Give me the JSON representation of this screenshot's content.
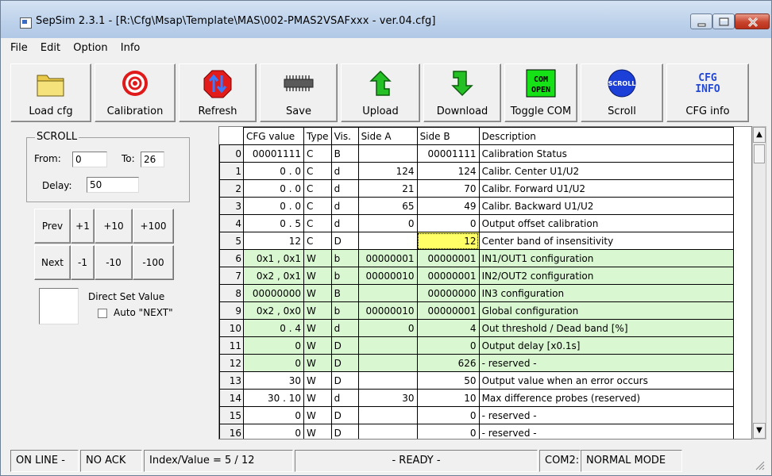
{
  "window": {
    "title": "SepSim 2.3.1 - [R:\\Cfg\\Msap\\Template\\MAS\\002-PMAS2VSAFxxx - ver.04.cfg]"
  },
  "menu": [
    {
      "label": "File"
    },
    {
      "label": "Edit"
    },
    {
      "label": "Option"
    },
    {
      "label": "Info"
    }
  ],
  "toolbar": [
    {
      "label": "Load cfg",
      "icon": "folder-icon"
    },
    {
      "label": "Calibration",
      "icon": "target-icon"
    },
    {
      "label": "Refresh",
      "icon": "refresh-arrows-icon"
    },
    {
      "label": "Save",
      "icon": "chip-icon"
    },
    {
      "label": "Upload",
      "icon": "upload-arrow-icon"
    },
    {
      "label": "Download",
      "icon": "download-arrow-icon"
    },
    {
      "label": "Toggle COM",
      "icon": "com-open-icon",
      "icon_text": [
        "COM",
        "OPEN"
      ]
    },
    {
      "label": "Scroll",
      "icon": "scroll-icon",
      "icon_text": "SCROLL"
    },
    {
      "label": "CFG info",
      "icon": "cfg-info-icon",
      "icon_text": [
        "CFG",
        "INFO"
      ]
    }
  ],
  "scroll": {
    "legend": "SCROLL",
    "from_label": "From:",
    "from_value": "0",
    "to_label": "To:",
    "to_value": "26",
    "delay_label": "Delay:",
    "delay_value": "50"
  },
  "step_buttons": {
    "prev": "Prev",
    "next": "Next",
    "p1": "+1",
    "p10": "+10",
    "p100": "+100",
    "m1": "-1",
    "m10": "-10",
    "m100": "-100"
  },
  "direct_set": {
    "label": "Direct Set Value",
    "auto_next": "Auto \"NEXT\""
  },
  "grid": {
    "columns": [
      "CFG value",
      "Type",
      "Vis.",
      "Side A",
      "Side B",
      "Description"
    ],
    "rows": [
      {
        "idx": "0",
        "cfg": "00001111",
        "type": "C",
        "vis": "B",
        "a": "",
        "b": "00001111",
        "desc": "Calibration Status",
        "green": false
      },
      {
        "idx": "1",
        "cfg": "0 .  0",
        "type": "C",
        "vis": "d",
        "a": "124",
        "b": "124",
        "desc": "Calibr. Center U1/U2",
        "green": false
      },
      {
        "idx": "2",
        "cfg": "0 .  0",
        "type": "C",
        "vis": "d",
        "a": "21",
        "b": "70",
        "desc": "Calibr. Forward U1/U2",
        "green": false
      },
      {
        "idx": "3",
        "cfg": "0 .  0",
        "type": "C",
        "vis": "d",
        "a": "65",
        "b": "49",
        "desc": "Calibr. Backward U1/U2",
        "green": false
      },
      {
        "idx": "4",
        "cfg": "0 .  5",
        "type": "C",
        "vis": "d",
        "a": "0",
        "b": "0",
        "desc": "Output offset calibration",
        "green": false
      },
      {
        "idx": "5",
        "cfg": "12",
        "type": "C",
        "vis": "D",
        "a": "",
        "b": "12",
        "desc": "Center band of insensitivity",
        "green": false,
        "selected_b": true
      },
      {
        "idx": "6",
        "cfg": "0x1 , 0x1",
        "type": "W",
        "vis": "b",
        "a": "00000001",
        "b": "00000001",
        "desc": "IN1/OUT1 configuration",
        "green": true
      },
      {
        "idx": "7",
        "cfg": "0x2 , 0x1",
        "type": "W",
        "vis": "b",
        "a": "00000010",
        "b": "00000001",
        "desc": "IN2/OUT2 configuration",
        "green": true
      },
      {
        "idx": "8",
        "cfg": "00000000",
        "type": "W",
        "vis": "B",
        "a": "",
        "b": "00000000",
        "desc": "IN3 configuration",
        "green": true
      },
      {
        "idx": "9",
        "cfg": "0x2 , 0x0",
        "type": "W",
        "vis": "b",
        "a": "00000010",
        "b": "00000001",
        "desc": "Global configuration",
        "green": true
      },
      {
        "idx": "10",
        "cfg": "0 .  4",
        "type": "W",
        "vis": "d",
        "a": "0",
        "b": "4",
        "desc": "Out threshold / Dead band [%]",
        "green": true
      },
      {
        "idx": "11",
        "cfg": "0",
        "type": "W",
        "vis": "D",
        "a": "",
        "b": "0",
        "desc": "Output delay [x0.1s]",
        "green": true
      },
      {
        "idx": "12",
        "cfg": "0",
        "type": "W",
        "vis": "D",
        "a": "",
        "b": "626",
        "desc": "- reserved -",
        "green": true
      },
      {
        "idx": "13",
        "cfg": "30",
        "type": "W",
        "vis": "D",
        "a": "",
        "b": "50",
        "desc": "Output value when an error occurs",
        "green": false
      },
      {
        "idx": "14",
        "cfg": "30 .  10",
        "type": "W",
        "vis": "d",
        "a": "30",
        "b": "10",
        "desc": "Max difference probes (reserved)",
        "green": false
      },
      {
        "idx": "15",
        "cfg": "0",
        "type": "W",
        "vis": "D",
        "a": "",
        "b": "0",
        "desc": "- reserved -",
        "green": false
      },
      {
        "idx": "16",
        "cfg": "0",
        "type": "W",
        "vis": "D",
        "a": "",
        "b": "0",
        "desc": "- reserved -",
        "green": false
      }
    ]
  },
  "status": {
    "line": "ON LINE  -",
    "ack": "NO ACK",
    "index": "Index/Value = 5 / 12",
    "ready": "- READY -",
    "com": "COM2:",
    "mode": "NORMAL MODE"
  },
  "colors": {
    "green_row": "#d9f7d1",
    "selected_cell": "#ffff66",
    "close_button": "#c8442c"
  }
}
